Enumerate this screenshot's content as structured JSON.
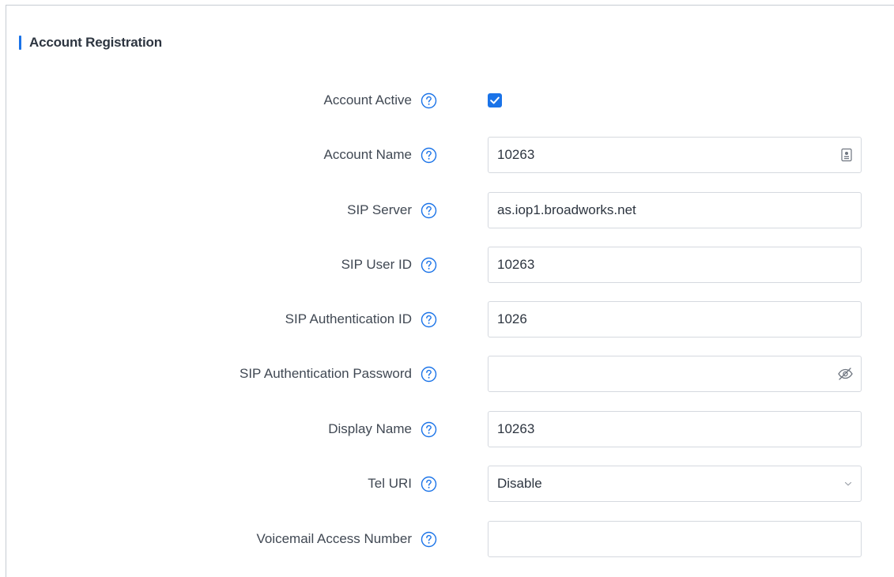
{
  "section": {
    "title": "Account Registration"
  },
  "fields": {
    "account_active": {
      "label": "Account Active",
      "checked": true
    },
    "account_name": {
      "label": "Account Name",
      "value": "10263",
      "suffix_icon": "contact-card-icon"
    },
    "sip_server": {
      "label": "SIP Server",
      "value": "as.iop1.broadworks.net"
    },
    "sip_user_id": {
      "label": "SIP User ID",
      "value": "10263"
    },
    "sip_auth_id": {
      "label": "SIP Authentication ID",
      "value": "1026"
    },
    "sip_auth_password": {
      "label": "SIP Authentication Password",
      "value": "",
      "suffix_icon": "password-visibility-icon"
    },
    "display_name": {
      "label": "Display Name",
      "value": "10263"
    },
    "tel_uri": {
      "label": "Tel URI",
      "selected": "Disable"
    },
    "voicemail_access_number": {
      "label": "Voicemail Access Number",
      "value": ""
    }
  },
  "colors": {
    "accent": "#1a73e8",
    "label_text": "#404853",
    "input_border": "#d5d9df"
  }
}
